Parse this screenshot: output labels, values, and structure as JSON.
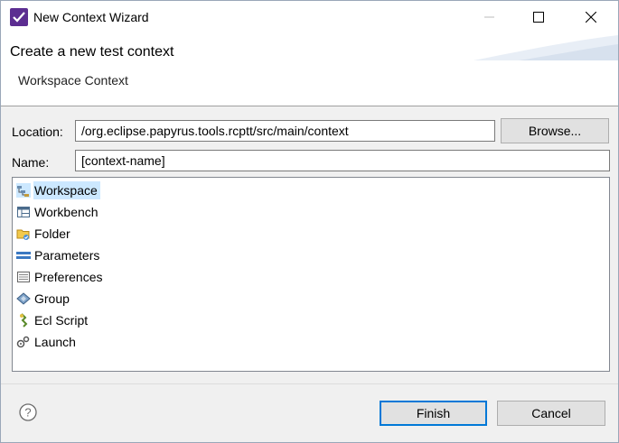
{
  "window": {
    "title": "New Context Wizard"
  },
  "banner": {
    "title": "Create a new test context",
    "message": "Workspace Context"
  },
  "form": {
    "location_label": "Location:",
    "location_value": "/org.eclipse.papyrus.tools.rcptt/src/main/context",
    "browse_label": "Browse...",
    "name_label": "Name:",
    "name_value": "[context-name]"
  },
  "context_types": [
    {
      "label": "Workspace",
      "icon": "workspace-icon",
      "selected": true
    },
    {
      "label": "Workbench",
      "icon": "workbench-icon",
      "selected": false
    },
    {
      "label": "Folder",
      "icon": "folder-icon",
      "selected": false
    },
    {
      "label": "Parameters",
      "icon": "parameters-icon",
      "selected": false
    },
    {
      "label": "Preferences",
      "icon": "preferences-icon",
      "selected": false
    },
    {
      "label": "Group",
      "icon": "group-icon",
      "selected": false
    },
    {
      "label": "Ecl Script",
      "icon": "ecl-script-icon",
      "selected": false
    },
    {
      "label": "Launch",
      "icon": "launch-icon",
      "selected": false
    }
  ],
  "buttons": {
    "finish": "Finish",
    "cancel": "Cancel"
  },
  "colors": {
    "accent": "#0078d7",
    "selection": "#cce8ff",
    "app_icon": "#5c2d91"
  }
}
